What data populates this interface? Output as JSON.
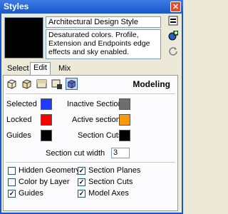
{
  "window": {
    "title": "Styles",
    "close_glyph": "✕"
  },
  "style": {
    "name": "Architectural Design Style",
    "description": "Desaturated colors. Profile, Extension and Endpoints edge effects and sky enabled."
  },
  "tabs": [
    {
      "label": "Select"
    },
    {
      "label": "Edit"
    },
    {
      "label": "Mix"
    }
  ],
  "section_title": "Modeling",
  "colors": {
    "selected": "#1f3bff",
    "locked": "#ff0000",
    "guides": "#000000",
    "inactive_section": "#6e6e6e",
    "active_section": "#ff9900",
    "section_cuts": "#000000"
  },
  "labels": {
    "selected": "Selected",
    "locked": "Locked",
    "guides": "Guides",
    "inactive_section": "Inactive Section",
    "active_section": "Active section",
    "section_cuts": "Section Cuts",
    "section_cut_width": "Section cut width"
  },
  "section_cut_width_value": "3",
  "checkboxes": {
    "hidden_geometry": {
      "label": "Hidden Geometry",
      "checked": false
    },
    "color_by_layer": {
      "label": "Color by Layer",
      "checked": false
    },
    "guides": {
      "label": "Guides",
      "checked": true
    },
    "section_planes": {
      "label": "Section Planes",
      "checked": true
    },
    "section_cuts": {
      "label": "Section Cuts",
      "checked": true
    },
    "model_axes": {
      "label": "Model Axes",
      "checked": true
    }
  },
  "icons": [
    "edge-settings-icon",
    "face-settings-icon",
    "background-settings-icon",
    "watermark-settings-icon",
    "modeling-settings-icon"
  ]
}
